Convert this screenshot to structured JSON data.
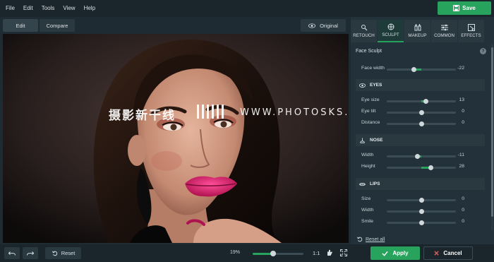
{
  "menu": [
    "File",
    "Edit",
    "Tools",
    "View",
    "Help"
  ],
  "toolbar": {
    "save_label": "Save"
  },
  "view": {
    "edit_label": "Edit",
    "compare_label": "Compare",
    "original_label": "Original"
  },
  "watermark": {
    "cn": "摄影新干线",
    "url": "WWW.PHOTOSKS.VIP"
  },
  "tools": [
    {
      "label": "RETOUCH",
      "icon": "retouch-icon"
    },
    {
      "label": "SCULPT",
      "icon": "sculpt-icon"
    },
    {
      "label": "MAKEUP",
      "icon": "makeup-icon"
    },
    {
      "label": "COMMON",
      "icon": "sliders-icon"
    },
    {
      "label": "EFFECTS",
      "icon": "effects-icon"
    }
  ],
  "panel": {
    "title": "Face Sculpt",
    "help": "?",
    "face_width": {
      "label": "Face width",
      "value": "-22",
      "level": -0.22
    },
    "eyes": {
      "title": "EYES",
      "rows": [
        {
          "label": "Eye size",
          "value": "13",
          "level": 0.13
        },
        {
          "label": "Eye tilt",
          "value": "0",
          "level": 0
        },
        {
          "label": "Distance",
          "value": "0",
          "level": 0
        }
      ]
    },
    "nose": {
      "title": "NOSE",
      "rows": [
        {
          "label": "Width",
          "value": "-11",
          "level": -0.11
        },
        {
          "label": "Height",
          "value": "28",
          "level": 0.28
        }
      ]
    },
    "lips": {
      "title": "LIPS",
      "rows": [
        {
          "label": "Size",
          "value": "0",
          "level": 0
        },
        {
          "label": "Width",
          "value": "0",
          "level": 0
        },
        {
          "label": "Smile",
          "value": "0",
          "level": 0
        }
      ]
    },
    "reset_all": "Reset all"
  },
  "bottom": {
    "reset_label": "Reset",
    "zoom": "19%",
    "zoom_level": 0.4,
    "one_to_one": "1:1",
    "apply_label": "Apply",
    "cancel_label": "Cancel"
  },
  "colors": {
    "accent": "#27a35d",
    "panel": "#22313a",
    "background": "#1e2b33"
  }
}
